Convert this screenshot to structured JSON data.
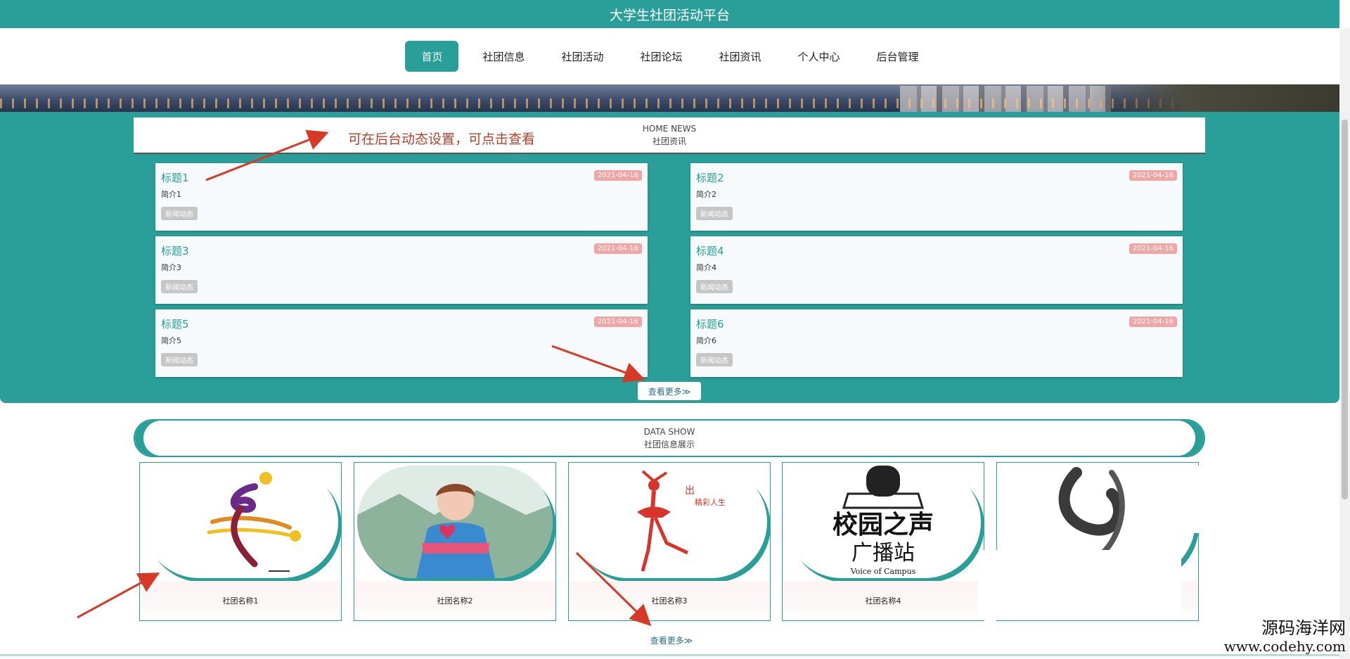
{
  "header": {
    "title": "大学生社团活动平台"
  },
  "nav": {
    "items": [
      {
        "label": "首页",
        "active": true
      },
      {
        "label": "社团信息"
      },
      {
        "label": "社团活动"
      },
      {
        "label": "社团论坛"
      },
      {
        "label": "社团资讯"
      },
      {
        "label": "个人中心"
      },
      {
        "label": "后台管理"
      }
    ]
  },
  "news": {
    "header_en": "HOME NEWS",
    "header_cn": "社团资讯",
    "items": [
      {
        "title": "标题1",
        "intro": "简介1",
        "date": "2021-04-16",
        "tag": "新闻动态"
      },
      {
        "title": "标题2",
        "intro": "简介2",
        "date": "2021-04-16",
        "tag": "新闻动态"
      },
      {
        "title": "标题3",
        "intro": "简介3",
        "date": "2021-04-16",
        "tag": "新闻动态"
      },
      {
        "title": "标题4",
        "intro": "简介4",
        "date": "2021-04-16",
        "tag": "新闻动态"
      },
      {
        "title": "标题5",
        "intro": "简介5",
        "date": "2021-04-16",
        "tag": "新闻动态"
      },
      {
        "title": "标题6",
        "intro": "简介6",
        "date": "2021-04-16",
        "tag": "新闻动态"
      }
    ],
    "more_label": "查看更多≫"
  },
  "show": {
    "header_en": "DATA SHOW",
    "header_cn": "社团信息展示",
    "clubs": [
      {
        "name": "社团名称1"
      },
      {
        "name": "社团名称2"
      },
      {
        "name": "社团名称3"
      },
      {
        "name": "社团名称4"
      },
      {
        "name": ""
      }
    ],
    "more_label": "查看更多≫"
  },
  "annotation": {
    "text": "可在后台动态设置，可点击查看"
  },
  "watermark": {
    "line1": "源码海洋网",
    "line2": "www.codehy.com"
  },
  "colors": {
    "primary": "#2a9e98",
    "date_badge": "#f1a6a6",
    "annotation": "#b9412c"
  }
}
